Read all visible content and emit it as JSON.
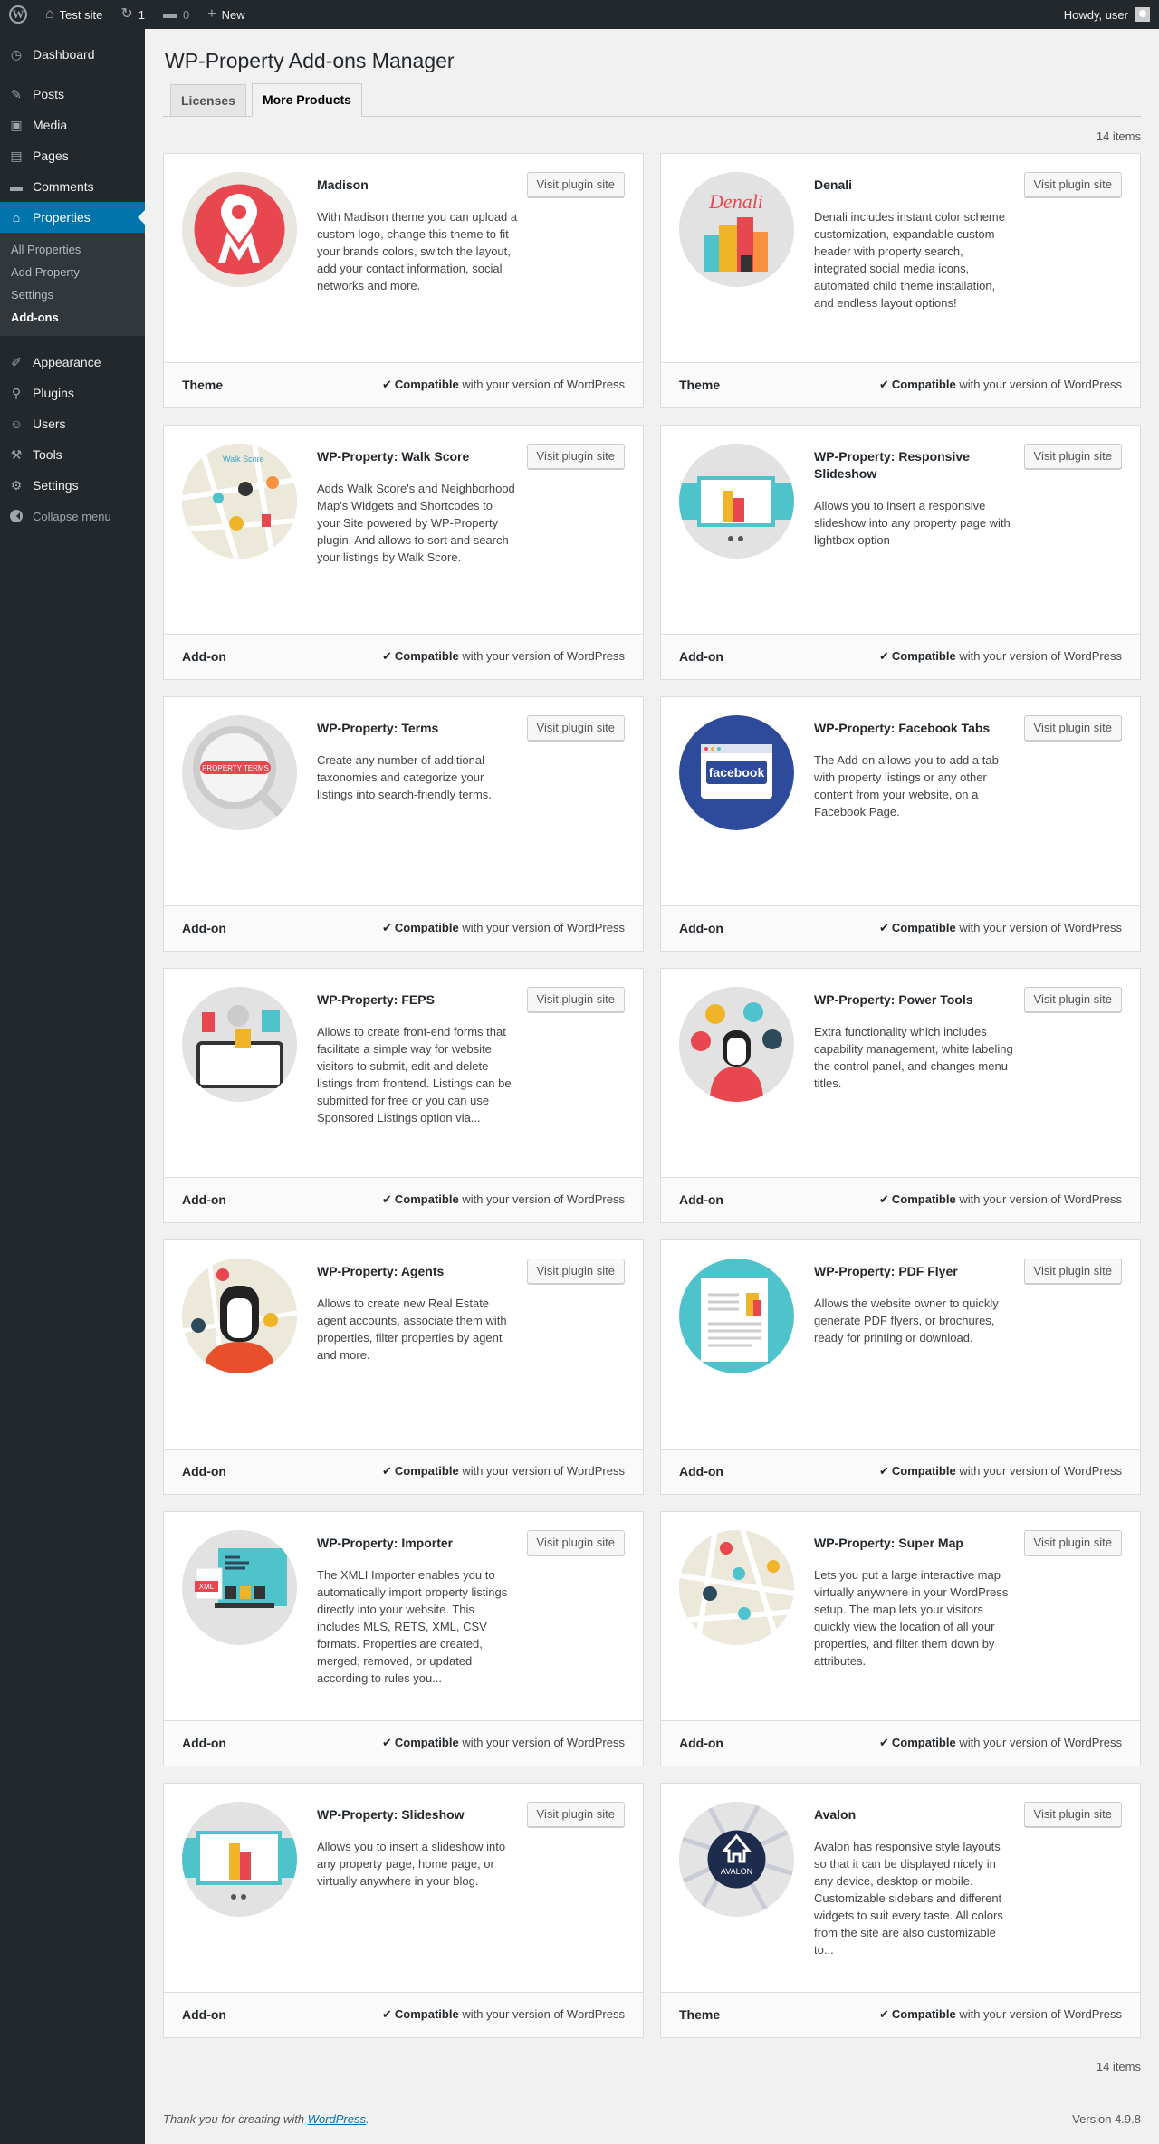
{
  "adminbar": {
    "site_name": "Test site",
    "updates_count": "1",
    "comments_count": "0",
    "new_label": "New",
    "howdy": "Howdy, user"
  },
  "sidebar": {
    "items": [
      {
        "label": "Dashboard",
        "icon": "dashboard-icon",
        "glyph": "◷"
      },
      {
        "label": "Posts",
        "icon": "pin-icon",
        "glyph": "✎"
      },
      {
        "label": "Media",
        "icon": "media-icon",
        "glyph": "▣"
      },
      {
        "label": "Pages",
        "icon": "pages-icon",
        "glyph": "▤"
      },
      {
        "label": "Comments",
        "icon": "comments-icon",
        "glyph": "▬"
      },
      {
        "label": "Properties",
        "icon": "home-icon",
        "glyph": "⌂"
      }
    ],
    "submenu": [
      "All Properties",
      "Add Property",
      "Settings",
      "Add-ons"
    ],
    "items2": [
      {
        "label": "Appearance",
        "icon": "brush-icon",
        "glyph": "✐"
      },
      {
        "label": "Plugins",
        "icon": "plug-icon",
        "glyph": "⚲"
      },
      {
        "label": "Users",
        "icon": "users-icon",
        "glyph": "☺"
      },
      {
        "label": "Tools",
        "icon": "wrench-icon",
        "glyph": "⚒"
      },
      {
        "label": "Settings",
        "icon": "settings-icon",
        "glyph": "⚙"
      }
    ],
    "collapse_label": "Collapse menu"
  },
  "page": {
    "title": "WP-Property Add-ons Manager",
    "tabs": [
      "Licenses",
      "More Products"
    ],
    "items_count": "14 items"
  },
  "card_common": {
    "button_label": "Visit plugin site",
    "compat_strong": "Compatible",
    "compat_rest": " with your version of WordPress"
  },
  "products": [
    {
      "name": "Madison",
      "type": "Theme",
      "desc": "With Madison theme you can upload a custom logo, change this theme to fit your brands colors, switch the layout, add your contact information, social networks and more.",
      "image": "madison-logo-icon"
    },
    {
      "name": "Denali",
      "type": "Theme",
      "desc": "Denali includes instant color scheme customization, expandable custom header with property search, integrated social media icons, automated child theme installation, and endless layout options!",
      "image": "denali-city-icon",
      "image_text": "Denali"
    },
    {
      "name": "WP-Property: Walk Score",
      "type": "Add-on",
      "desc": "Adds Walk Score's and Neighborhood Map's Widgets and Shortcodes to your Site powered by WP-Property plugin. And allows to sort and search your listings by Walk Score.",
      "image": "walk-score-map-icon",
      "image_text": "Walk Score"
    },
    {
      "name": "WP-Property: Responsive Slideshow",
      "type": "Add-on",
      "desc": "Allows you to insert a responsive slideshow into any property page with lightbox option",
      "image": "responsive-slideshow-icon"
    },
    {
      "name": "WP-Property: Terms",
      "type": "Add-on",
      "desc": "Create any number of additional taxonomies and categorize your listings into search-friendly terms.",
      "image": "property-terms-icon",
      "image_text": "PROPERTY TERMS"
    },
    {
      "name": "WP-Property: Facebook Tabs",
      "type": "Add-on",
      "desc": "The Add-on allows you to add a tab with property listings or any other content from your website, on a Facebook Page.",
      "image": "facebook-tabs-icon",
      "image_text": "facebook"
    },
    {
      "name": "WP-Property: FEPS",
      "type": "Add-on",
      "desc": "Allows to create front-end forms that facilitate a simple way for website visitors to submit, edit and delete listings from frontend. Listings can be submitted for free or you can use Sponsored Listings option via...",
      "image": "feps-form-icon"
    },
    {
      "name": "WP-Property: Power Tools",
      "type": "Add-on",
      "desc": "Extra functionality which includes capability management, white labeling the control panel, and changes menu titles.",
      "image": "power-tools-users-icon"
    },
    {
      "name": "WP-Property: Agents",
      "type": "Add-on",
      "desc": "Allows to create new Real Estate agent accounts, associate them with properties, filter properties by agent and more.",
      "image": "agent-person-icon"
    },
    {
      "name": "WP-Property: PDF Flyer",
      "type": "Add-on",
      "desc": "Allows the website owner to quickly generate PDF flyers, or brochures, ready for printing or download.",
      "image": "pdf-flyer-icon"
    },
    {
      "name": "WP-Property: Importer",
      "type": "Add-on",
      "desc": "The XMLI Importer enables you to automatically import property listings directly into your website. This includes MLS, RETS, XML, CSV formats. Properties are created, merged, removed, or updated according to rules you...",
      "image": "importer-xml-icon",
      "image_text": "XML"
    },
    {
      "name": "WP-Property: Super Map",
      "type": "Add-on",
      "desc": "Lets you put a large interactive map virtually anywhere in your WordPress setup. The map lets your visitors quickly view the location of all your properties, and filter them down by attributes.",
      "image": "super-map-pins-icon"
    },
    {
      "name": "WP-Property: Slideshow",
      "type": "Add-on",
      "desc": "Allows you to insert a slideshow into any property page, home page, or virtually anywhere in your blog.",
      "image": "slideshow-icon"
    },
    {
      "name": "Avalon",
      "type": "Theme",
      "desc": "Avalon has responsive style layouts so that it can be displayed nicely in any device, desktop or mobile. Customizable sidebars and different widgets to suit every taste. All colors from the site are also customizable to...",
      "image": "avalon-logo-icon",
      "image_text": "AVALON"
    }
  ],
  "footer": {
    "thanks_prefix": "Thank you for creating with ",
    "thanks_link": "WordPress",
    "thanks_suffix": ".",
    "version": "Version 4.9.8"
  },
  "colors": {
    "accent": "#0073aa",
    "adminbar": "#23282d",
    "madison_red": "#e8474f",
    "facebook_blue": "#2d4a9b",
    "teal": "#4ec3cc"
  }
}
